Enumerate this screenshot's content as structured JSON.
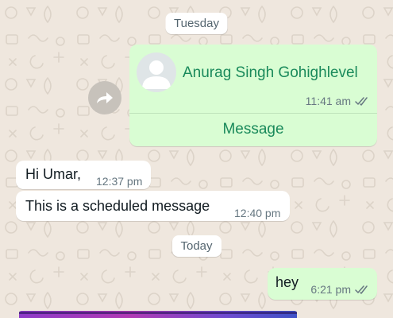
{
  "chat": {
    "day_separators": [
      "Tuesday",
      "Today"
    ],
    "contact_card": {
      "name": "Anurag Singh Gohighlevel",
      "time": "11:41 am",
      "action_label": "Message",
      "status_icon": "double-check-icon"
    },
    "messages_in": [
      {
        "text": "Hi Umar,",
        "time": "12:37 pm"
      },
      {
        "text": "This is a scheduled message",
        "time": "12:40 pm"
      }
    ],
    "message_out": {
      "text": "hey",
      "time": "6:21 pm",
      "status_icon": "double-check-icon"
    }
  },
  "colors": {
    "outgoing_bubble": "#d9fdd3",
    "incoming_bubble": "#ffffff",
    "accent_green": "#1a8a5b",
    "wallpaper": "#efe7de"
  }
}
